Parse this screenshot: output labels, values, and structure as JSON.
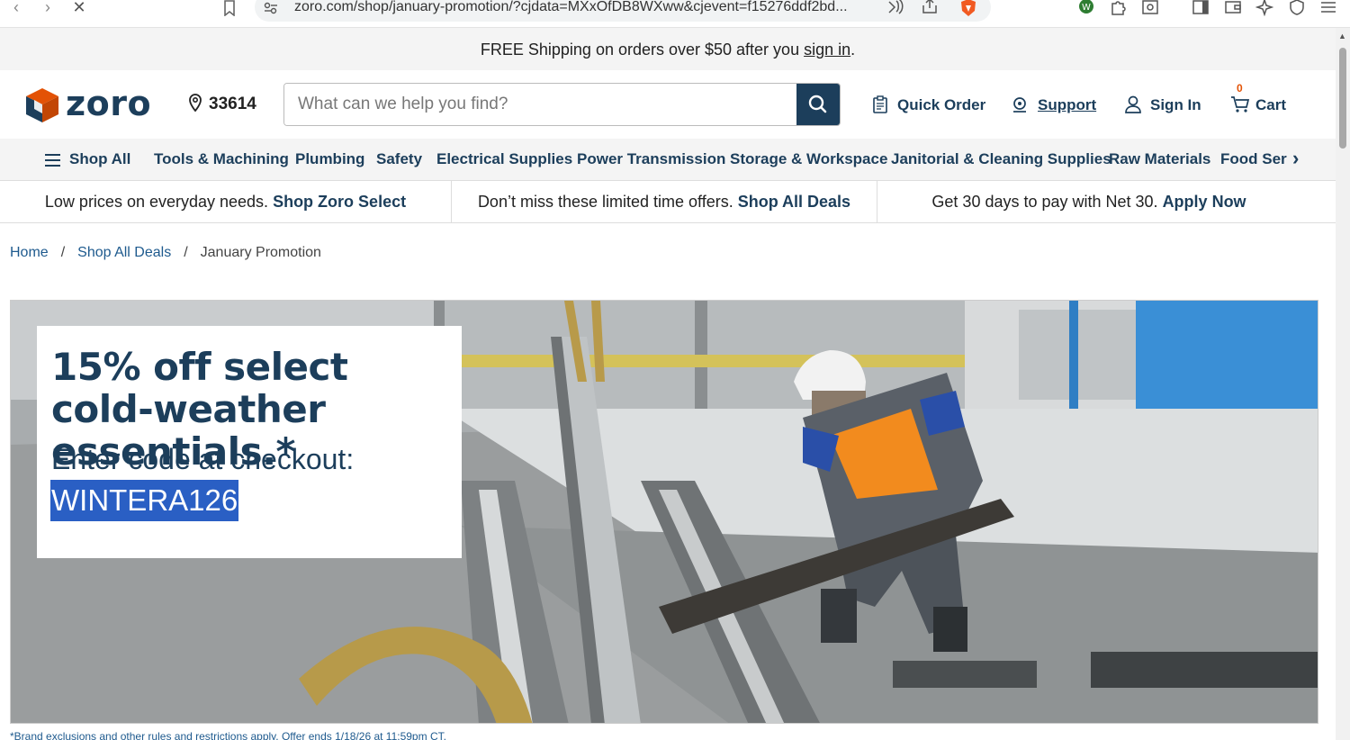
{
  "browser": {
    "url": "zoro.com/shop/january-promotion/?cjdata=MXxOfDB8WXww&cjevent=f15276ddf2bd...",
    "icons": [
      "back-icon",
      "forward-icon",
      "stop-icon",
      "bookmark-icon",
      "site-info-icon",
      "read-aloud-icon",
      "share-icon",
      "brave-shield-icon",
      "extension-icon",
      "puzzle-icon",
      "screenshot-icon",
      "sidebar-icon",
      "wallet-icon",
      "leo-icon",
      "vpn-icon",
      "menu-icon"
    ]
  },
  "promo_bar": {
    "text": "FREE Shipping on orders over $50 after you ",
    "link": "sign in",
    "suffix": "."
  },
  "header": {
    "logo_text": "zoro",
    "zip": "33614",
    "search_placeholder": "What can we help you find?",
    "quick_order": "Quick Order",
    "support": "Support",
    "sign_in": "Sign In",
    "cart": "Cart",
    "cart_count": "0"
  },
  "catnav": {
    "shop_all": "Shop All",
    "items": [
      "Tools & Machining",
      "Plumbing",
      "Safety",
      "Electrical Supplies",
      "Power Transmission",
      "Storage & Workspace",
      "Janitorial & Cleaning Supplies",
      "Raw Materials",
      "Food Serv"
    ]
  },
  "offers": [
    {
      "text": "Low prices on everyday needs. ",
      "cta": "Shop Zoro Select"
    },
    {
      "text": "Don’t miss these limited time offers. ",
      "cta": "Shop All Deals"
    },
    {
      "text": "Get 30 days to pay with Net 30. ",
      "cta": "Apply Now"
    }
  ],
  "breadcrumb": {
    "home": "Home",
    "deals": "Shop All Deals",
    "current": "January Promotion",
    "sep": "/"
  },
  "hero": {
    "headline": "15% off select cold-weather essentials.*",
    "subline": "Enter code at checkout:",
    "code": "WINTERA126"
  },
  "fineprint": "*Brand exclusions and other rules and restrictions apply. Offer ends 1/18/26 at 11:59pm CT."
}
